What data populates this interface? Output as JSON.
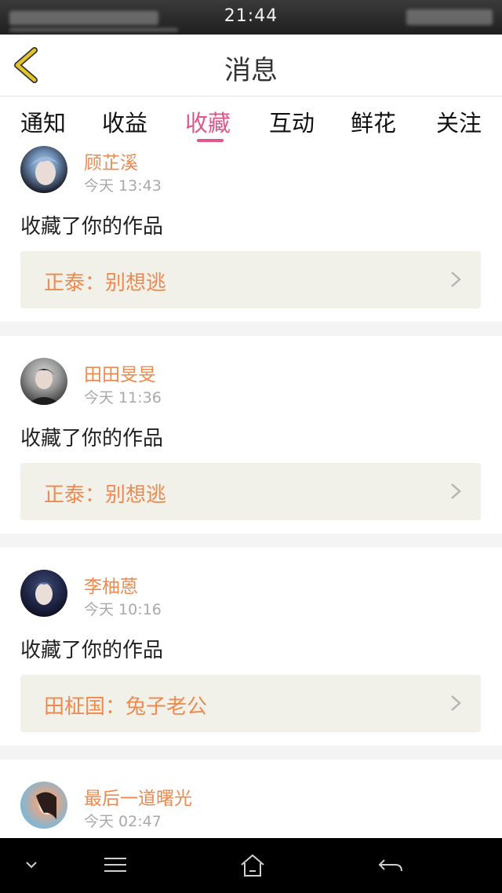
{
  "status_bar": {
    "time": "21:44"
  },
  "header": {
    "title": "消息"
  },
  "tabs": [
    {
      "label": "通知"
    },
    {
      "label": "收益"
    },
    {
      "label": "收藏"
    },
    {
      "label": "互动"
    },
    {
      "label": "鲜花"
    },
    {
      "label": "关注"
    }
  ],
  "active_tab": "收藏",
  "notifications": [
    {
      "user": "顾芷溪",
      "time": "今天 13:43",
      "action": "收藏了你的作品",
      "work": "正泰：别想逃"
    },
    {
      "user": "田田旻旻",
      "time": "今天 11:36",
      "action": "收藏了你的作品",
      "work": "正泰：别想逃"
    },
    {
      "user": "李柚蒽",
      "time": "今天 10:16",
      "action": "收藏了你的作品",
      "work": "田柾国：兔子老公"
    },
    {
      "user": "最后一道曙光",
      "time": "今天 02:47"
    }
  ],
  "colors": {
    "accent_pink": "#e0578d",
    "username_orange": "#ee8a4f",
    "work_card_bg": "#f1f1e9",
    "back_arrow_yellow": "#e3c52b"
  },
  "icons": {
    "back": "chevron-left-icon",
    "work_chevron": "chevron-right-icon",
    "system": [
      "chevron-down-icon",
      "menu-icon",
      "home-icon",
      "back-arrow-icon"
    ]
  }
}
